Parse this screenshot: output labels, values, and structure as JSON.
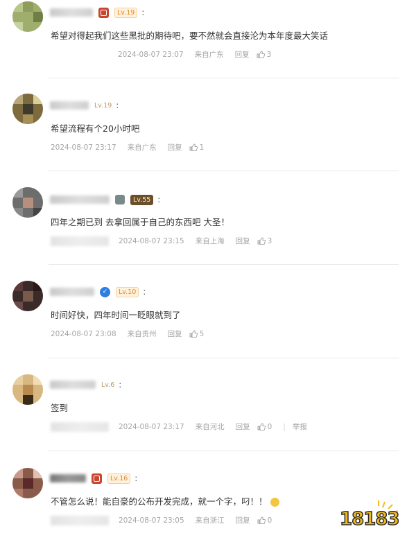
{
  "comments": [
    {
      "level": "Lv.19",
      "text": "希望对得起我们这些黑批的期待吧，要不然就会直接沦为本年度最大笑话",
      "time": "2024-08-07 23:07",
      "location": "来自广东",
      "reply": "回复",
      "likes": "3"
    },
    {
      "level": "Lv.19",
      "text": "希望流程有个20小时吧",
      "time": "2024-08-07 23:17",
      "location": "来自广东",
      "reply": "回复",
      "likes": "1"
    },
    {
      "level": "Lv.55",
      "text": "四年之期已到 去拿回属于自己的东西吧 大圣！",
      "time": "2024-08-07 23:15",
      "location": "来自上海",
      "reply": "回复",
      "likes": "3"
    },
    {
      "level": "Lv.10",
      "text": "时间好快，四年时间一眨眼就到了",
      "time": "2024-08-07 23:08",
      "location": "来自贵州",
      "reply": "回复",
      "likes": "5"
    },
    {
      "level": "Lv.6",
      "text": "签到",
      "time": "2024-08-07 23:17",
      "location": "来自河北",
      "reply": "回复",
      "likes": "0",
      "report": "举报"
    },
    {
      "level": "Lv.16",
      "text": "不管怎么说！能自豪的公布开发完成，就一个字，叼！！",
      "time": "2024-08-07 23:05",
      "location": "来自浙江",
      "reply": "回复",
      "likes": "0"
    }
  ],
  "watermark": "18183",
  "colors": {
    "level_orange": "#e2872a",
    "level_dark_bg": "#6b4f2a",
    "meta_gray": "#a5a5a5",
    "divider": "#e9e9e9"
  },
  "icons": {
    "badge": "medal-icon",
    "verify": "verified-icon",
    "like": "thumbs-up-icon",
    "emoji": "face-emoji-icon"
  }
}
